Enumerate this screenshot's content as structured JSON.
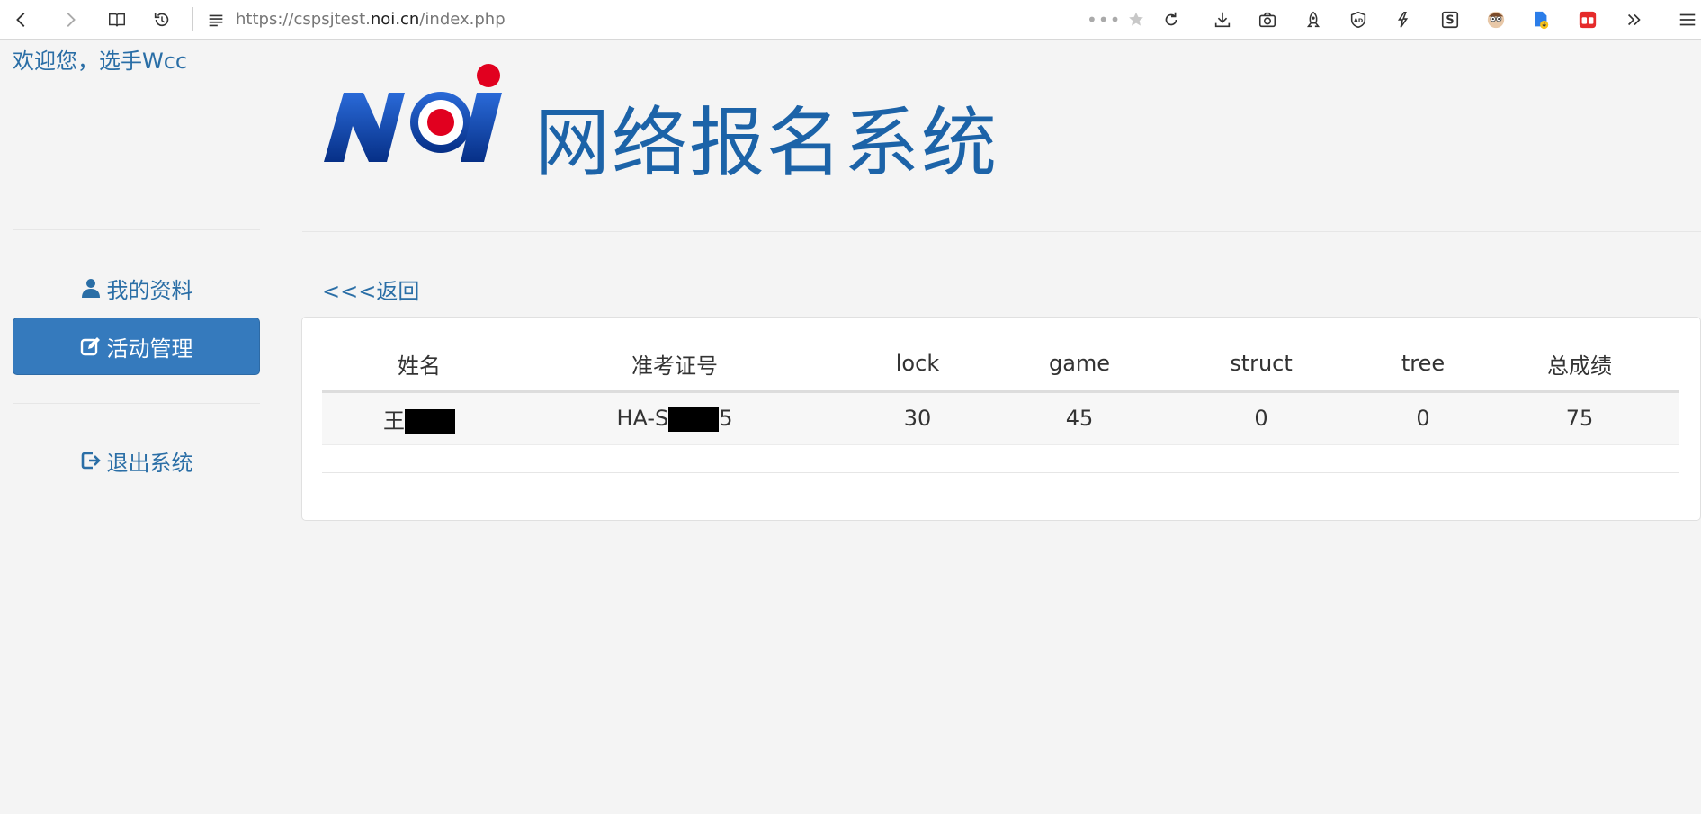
{
  "browser": {
    "url_prefix": "https://cspsjtest.",
    "url_host": "noi.cn",
    "url_suffix": "/index.php",
    "more_dots": "•••",
    "icons": [
      "back-icon",
      "forward-icon",
      "reader-icon",
      "history-icon",
      "page-menu-icon",
      "bookmark-star-icon",
      "reload-icon",
      "download-icon",
      "camera-icon",
      "rocket-icon",
      "adblock-icon",
      "extension-icon",
      "s-icon",
      "avatar-icon",
      "file-icon",
      "app-icon",
      "overflow-icon",
      "menu-icon"
    ]
  },
  "header": {
    "welcome": "欢迎您，选手Wcc",
    "site_title": "网络报名系统"
  },
  "nav": {
    "profile": "我的资料",
    "activity": "活动管理",
    "logout": "退出系统"
  },
  "back_link": "<<<返回",
  "table": {
    "headers": [
      "姓名",
      "准考证号",
      "lock",
      "game",
      "struct",
      "tree",
      "总成绩"
    ],
    "row": {
      "name_visible": "王",
      "exam_prefix": "HA-S",
      "exam_suffix": "5",
      "lock": "30",
      "game": "45",
      "struct": "0",
      "tree": "0",
      "total": "75"
    }
  },
  "colors": {
    "accent": "#357abd",
    "link": "#2a6ea6",
    "title": "#1c63a8",
    "logo_red": "#e1001f",
    "logo_blue": "#0a3d9c"
  }
}
